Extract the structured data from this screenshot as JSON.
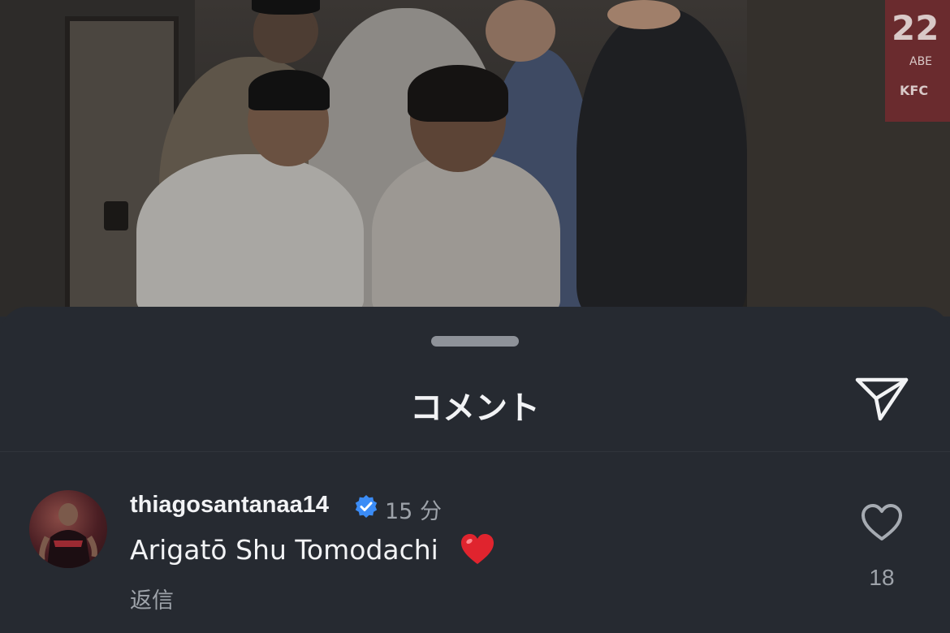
{
  "photo": {
    "jersey_number": "22",
    "jersey_name": "ABE",
    "jersey_brand": "KFC"
  },
  "sheet": {
    "title": "コメント",
    "share_icon": "send-icon"
  },
  "comments": [
    {
      "username": "thiagosantanaa14",
      "verified": true,
      "time": "15 分",
      "text": "Arigatō Shu Tomodachi",
      "emoji": "red-heart-emoji",
      "reply_label": "返信",
      "like_count": "18",
      "like_icon": "heart-outline-icon"
    }
  ],
  "colors": {
    "sheet_background": "#262a31",
    "verified_badge": "#3b8cf6",
    "emoji_heart": "#e0242e",
    "secondary_text": "#9ea3aa"
  }
}
